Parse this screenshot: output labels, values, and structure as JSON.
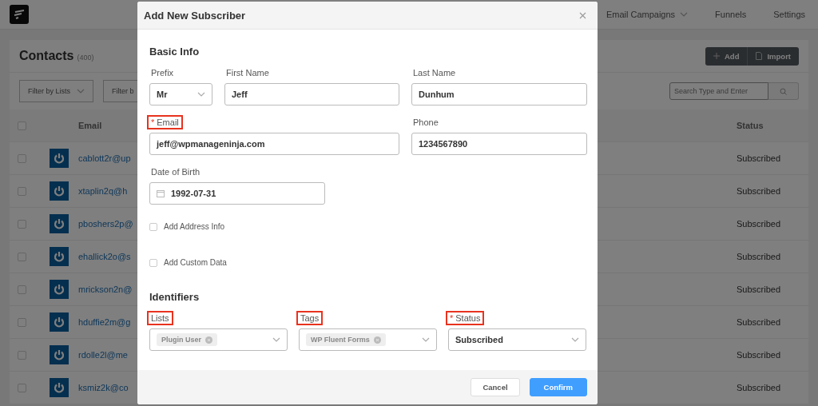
{
  "nav": {
    "items": [
      {
        "label": "Email Campaigns",
        "dropdown": true
      },
      {
        "label": "Funnels",
        "dropdown": false
      },
      {
        "label": "Settings",
        "dropdown": false
      }
    ]
  },
  "contacts": {
    "title": "Contacts",
    "count": "(400)",
    "buttons": [
      {
        "label": "Add",
        "kind": "add"
      },
      {
        "label": "Import",
        "kind": "import"
      }
    ],
    "filters": [
      {
        "label": "Filter by Lists",
        "dropdown": true
      },
      {
        "label": "Filter b",
        "dropdown": false
      }
    ],
    "search": {
      "placeholder": "Search Type and Enter"
    },
    "table": {
      "header_checked": false,
      "columns": [
        "Email",
        "Status"
      ],
      "rows": [
        {
          "checked": false,
          "email": "cablott2r@up",
          "status": "Subscribed"
        },
        {
          "checked": false,
          "email": "xtaplin2q@h",
          "status": "Subscribed"
        },
        {
          "checked": false,
          "email": "pboshers2p@",
          "status": "Subscribed"
        },
        {
          "checked": false,
          "email": "ehallick2o@s",
          "status": "Subscribed"
        },
        {
          "checked": false,
          "email": "mrickson2n@",
          "status": "Subscribed"
        },
        {
          "checked": false,
          "email": "hduffie2m@g",
          "status": "Subscribed"
        },
        {
          "checked": false,
          "email": "rdolle2l@me",
          "status": "Subscribed"
        },
        {
          "checked": false,
          "email": "ksmiz2k@co",
          "status": "Subscribed"
        }
      ]
    }
  },
  "modal": {
    "title": "Add New Subscriber",
    "basic_info": {
      "heading": "Basic Info",
      "fields": [
        {
          "kind": "select",
          "label": "Prefix",
          "value": "Mr",
          "highlighted": false
        },
        {
          "kind": "text",
          "label": "First Name",
          "value": "Jeff",
          "highlighted": false
        },
        {
          "kind": "text",
          "label": "Last Name",
          "value": "Dunhum",
          "highlighted": false
        },
        {
          "kind": "text",
          "label": "Email",
          "required_mark": "*",
          "value": "jeff@wpmanageninja.com",
          "highlighted": true
        },
        {
          "kind": "text",
          "label": "Phone",
          "value": "1234567890",
          "highlighted": false
        },
        {
          "kind": "date",
          "label": "Date of Birth",
          "value": "1992-07-31",
          "highlighted": false
        }
      ]
    },
    "options": [
      {
        "label": "Add Address Info",
        "checked": false
      },
      {
        "label": "Add Custom Data",
        "checked": false
      }
    ],
    "identifiers": {
      "heading": "Identifiers",
      "fields": [
        {
          "kind": "tags",
          "label": "Lists",
          "tags": [
            "Plugin User"
          ],
          "highlighted": true
        },
        {
          "kind": "tags",
          "label": "Tags",
          "tags": [
            "WP Fluent Forms"
          ],
          "highlighted": true
        },
        {
          "kind": "select",
          "label": "Status",
          "required_mark": "*",
          "value": "Subscribed",
          "highlighted": true
        }
      ]
    },
    "buttons": [
      {
        "label": "Cancel",
        "kind": "secondary"
      },
      {
        "label": "Confirm",
        "kind": "primary"
      }
    ]
  }
}
